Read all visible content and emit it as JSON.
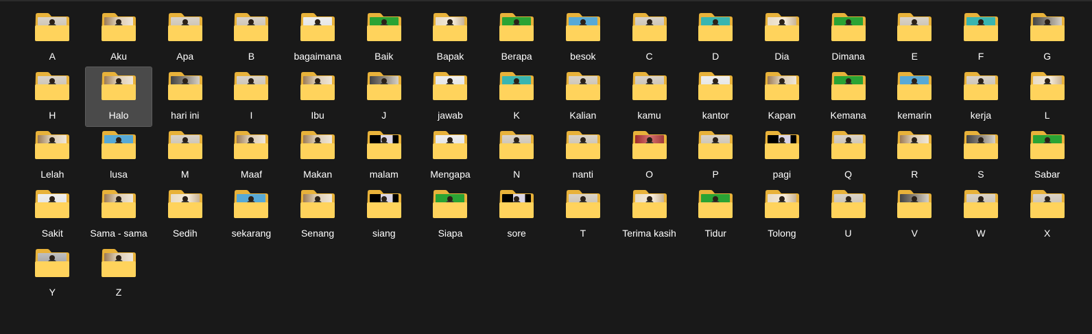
{
  "icon": "folder-icon",
  "colors": {
    "background": "#191919",
    "folder_back": "#E8B23A",
    "folder_front": "#FFD35C",
    "selection": "#4a4a4a"
  },
  "selected_index": 17,
  "folders": [
    {
      "label": "A",
      "thumb": "t-room"
    },
    {
      "label": "Aku",
      "thumb": "t-wood"
    },
    {
      "label": "Apa",
      "thumb": "t-room"
    },
    {
      "label": "B",
      "thumb": "t-room"
    },
    {
      "label": "bagaimana",
      "thumb": "t-white"
    },
    {
      "label": "Baik",
      "thumb": "t-green"
    },
    {
      "label": "Bapak",
      "thumb": "t-warm"
    },
    {
      "label": "Berapa",
      "thumb": "t-green"
    },
    {
      "label": "besok",
      "thumb": "t-blue"
    },
    {
      "label": "C",
      "thumb": "t-room"
    },
    {
      "label": "D",
      "thumb": "t-teal"
    },
    {
      "label": "Dia",
      "thumb": "t-warm"
    },
    {
      "label": "Dimana",
      "thumb": "t-green"
    },
    {
      "label": "E",
      "thumb": "t-room"
    },
    {
      "label": "F",
      "thumb": "t-teal"
    },
    {
      "label": "G",
      "thumb": "t-dark"
    },
    {
      "label": "H",
      "thumb": "t-room"
    },
    {
      "label": "Halo",
      "thumb": "t-wood"
    },
    {
      "label": "hari ini",
      "thumb": "t-dark"
    },
    {
      "label": "I",
      "thumb": "t-room"
    },
    {
      "label": "Ibu",
      "thumb": "t-wood"
    },
    {
      "label": "J",
      "thumb": "t-dark"
    },
    {
      "label": "jawab",
      "thumb": "t-white"
    },
    {
      "label": "K",
      "thumb": "t-teal"
    },
    {
      "label": "Kalian",
      "thumb": "t-room"
    },
    {
      "label": "kamu",
      "thumb": "t-room"
    },
    {
      "label": "kantor",
      "thumb": "t-white"
    },
    {
      "label": "Kapan",
      "thumb": "t-wood"
    },
    {
      "label": "Kemana",
      "thumb": "t-green"
    },
    {
      "label": "kemarin",
      "thumb": "t-blue"
    },
    {
      "label": "kerja",
      "thumb": "t-room"
    },
    {
      "label": "L",
      "thumb": "t-warm"
    },
    {
      "label": "Lelah",
      "thumb": "t-wood"
    },
    {
      "label": "lusa",
      "thumb": "t-blue"
    },
    {
      "label": "M",
      "thumb": "t-room"
    },
    {
      "label": "Maaf",
      "thumb": "t-wood"
    },
    {
      "label": "Makan",
      "thumb": "t-wood"
    },
    {
      "label": "malam",
      "thumb": "t-black"
    },
    {
      "label": "Mengapa",
      "thumb": "t-white"
    },
    {
      "label": "N",
      "thumb": "t-room"
    },
    {
      "label": "nanti",
      "thumb": "t-room"
    },
    {
      "label": "O",
      "thumb": "t-red"
    },
    {
      "label": "P",
      "thumb": "t-room"
    },
    {
      "label": "pagi",
      "thumb": "t-black"
    },
    {
      "label": "Q",
      "thumb": "t-room"
    },
    {
      "label": "R",
      "thumb": "t-wood"
    },
    {
      "label": "S",
      "thumb": "t-dark"
    },
    {
      "label": "Sabar",
      "thumb": "t-green"
    },
    {
      "label": "Sakit",
      "thumb": "t-white"
    },
    {
      "label": "Sama - sama",
      "thumb": "t-wood"
    },
    {
      "label": "Sedih",
      "thumb": "t-warm"
    },
    {
      "label": "sekarang",
      "thumb": "t-blue"
    },
    {
      "label": "Senang",
      "thumb": "t-wood"
    },
    {
      "label": "siang",
      "thumb": "t-black"
    },
    {
      "label": "Siapa",
      "thumb": "t-green"
    },
    {
      "label": "sore",
      "thumb": "t-black"
    },
    {
      "label": "T",
      "thumb": "t-room"
    },
    {
      "label": "Terima kasih",
      "thumb": "t-warm"
    },
    {
      "label": "Tidur",
      "thumb": "t-green"
    },
    {
      "label": "Tolong",
      "thumb": "t-warm"
    },
    {
      "label": "U",
      "thumb": "t-room"
    },
    {
      "label": "V",
      "thumb": "t-dark"
    },
    {
      "label": "W",
      "thumb": "t-room"
    },
    {
      "label": "X",
      "thumb": "t-room"
    },
    {
      "label": "Y",
      "thumb": "t-gray"
    },
    {
      "label": "Z",
      "thumb": "t-wood"
    }
  ]
}
